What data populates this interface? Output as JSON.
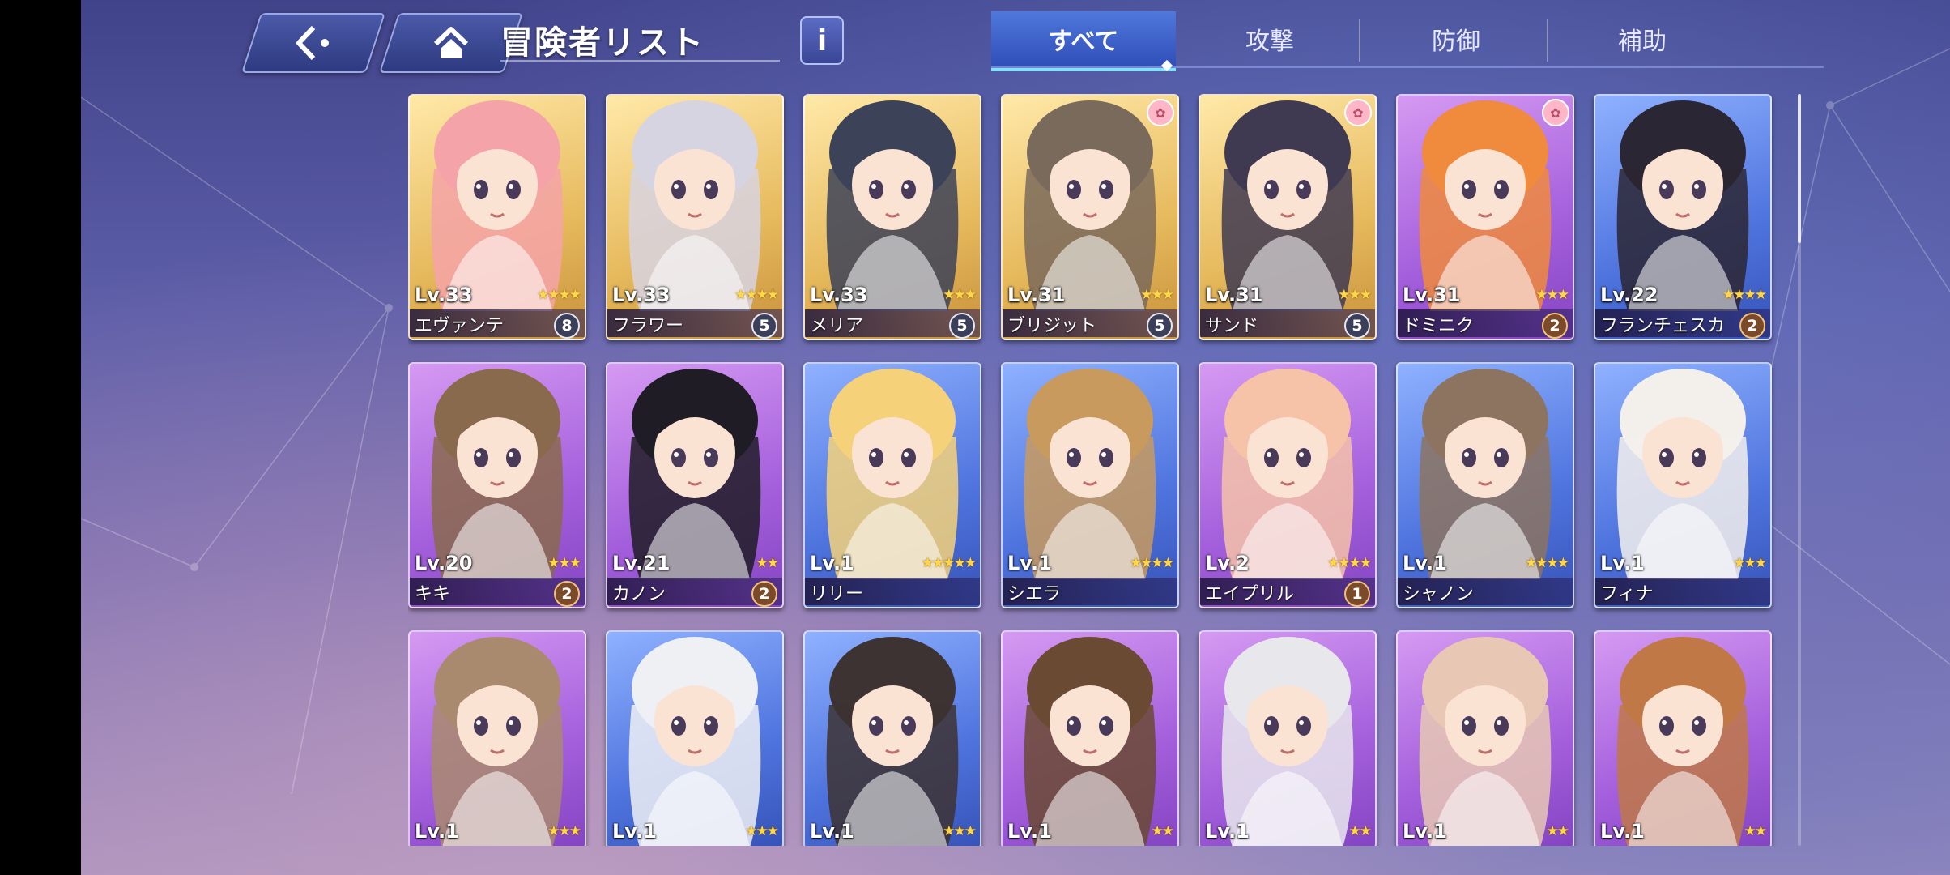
{
  "header": {
    "title": "冒険者リスト",
    "info_label": "i"
  },
  "tabs": [
    {
      "label": "すべて",
      "active": true
    },
    {
      "label": "攻撃",
      "active": false
    },
    {
      "label": "防御",
      "active": false
    },
    {
      "label": "補助",
      "active": false
    }
  ],
  "cards": [
    {
      "level": "Lv.33",
      "name": "エヴァンテ",
      "stars": "★★★★",
      "badge": "8",
      "frame": "gold"
    },
    {
      "level": "Lv.33",
      "name": "フラワー",
      "stars": "★★★★",
      "badge": "5",
      "frame": "gold"
    },
    {
      "level": "Lv.33",
      "name": "メリア",
      "stars": "★★★",
      "badge": "5",
      "frame": "gold"
    },
    {
      "level": "Lv.31",
      "name": "ブリジット",
      "stars": "★★★",
      "badge": "5",
      "frame": "gold",
      "paw": true
    },
    {
      "level": "Lv.31",
      "name": "サンド",
      "stars": "★★★",
      "badge": "5",
      "frame": "gold",
      "paw": true
    },
    {
      "level": "Lv.31",
      "name": "ドミニク",
      "stars": "★★★",
      "badge": "2",
      "frame": "purple",
      "paw": true
    },
    {
      "level": "Lv.22",
      "name": "フランチェスカ",
      "stars": "★★★★",
      "badge": "2",
      "frame": "blue"
    },
    {
      "level": "Lv.20",
      "name": "キキ",
      "stars": "★★★",
      "badge": "2",
      "frame": "purple"
    },
    {
      "level": "Lv.21",
      "name": "カノン",
      "stars": "★★",
      "badge": "2",
      "frame": "purple"
    },
    {
      "level": "Lv.1",
      "name": "リリー",
      "stars": "★★★★★",
      "badge": "",
      "frame": "blue"
    },
    {
      "level": "Lv.1",
      "name": "シエラ",
      "stars": "★★★★",
      "badge": "",
      "frame": "blue"
    },
    {
      "level": "Lv.2",
      "name": "エイプリル",
      "stars": "★★★★",
      "badge": "1",
      "frame": "purple"
    },
    {
      "level": "Lv.1",
      "name": "シャノン",
      "stars": "★★★★",
      "badge": "",
      "frame": "blue"
    },
    {
      "level": "Lv.1",
      "name": "フィナ",
      "stars": "★★★",
      "badge": "",
      "frame": "blue"
    },
    {
      "level": "Lv.1",
      "name": "",
      "stars": "★★★",
      "badge": "",
      "frame": "purple"
    },
    {
      "level": "Lv.1",
      "name": "",
      "stars": "★★★",
      "badge": "",
      "frame": "blue"
    },
    {
      "level": "Lv.1",
      "name": "",
      "stars": "★★★",
      "badge": "",
      "frame": "blue"
    },
    {
      "level": "Lv.1",
      "name": "",
      "stars": "★★",
      "badge": "",
      "frame": "purple"
    },
    {
      "level": "Lv.1",
      "name": "",
      "stars": "★★",
      "badge": "",
      "frame": "purple"
    },
    {
      "level": "Lv.1",
      "name": "",
      "stars": "★★",
      "badge": "",
      "frame": "purple"
    },
    {
      "level": "Lv.1",
      "name": "",
      "stars": "★★",
      "badge": "",
      "frame": "purple"
    }
  ]
}
